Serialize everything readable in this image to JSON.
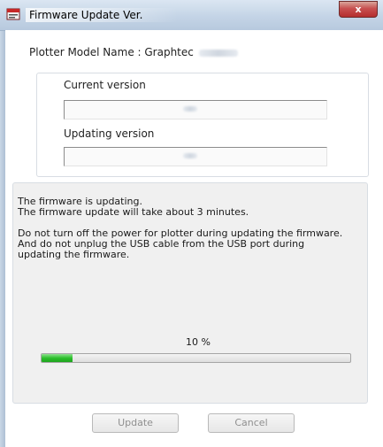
{
  "window": {
    "title": "Firmware Update Ver.",
    "close_symbol": "x"
  },
  "model": {
    "label": "Plotter Model Name : Graphtec"
  },
  "versions": {
    "current_label": "Current version",
    "updating_label": "Updating version"
  },
  "message": {
    "line1": "The firmware is updating.",
    "line2": "The firmware update will take about 3 minutes.",
    "line3": "Do not turn off the power for plotter during updating the firmware.",
    "line4": "And do not unplug the USB cable from the USB port during",
    "line5": "updating the firmware."
  },
  "progress": {
    "percent_text": "10 %",
    "fraction": 0.1
  },
  "buttons": {
    "update_label": "Update",
    "cancel_label": "Cancel"
  },
  "colors": {
    "progress_fill": "#2dbf2d",
    "close_button": "#c75050"
  },
  "icons": {
    "title": "firmware-app-icon",
    "close": "close-icon"
  }
}
